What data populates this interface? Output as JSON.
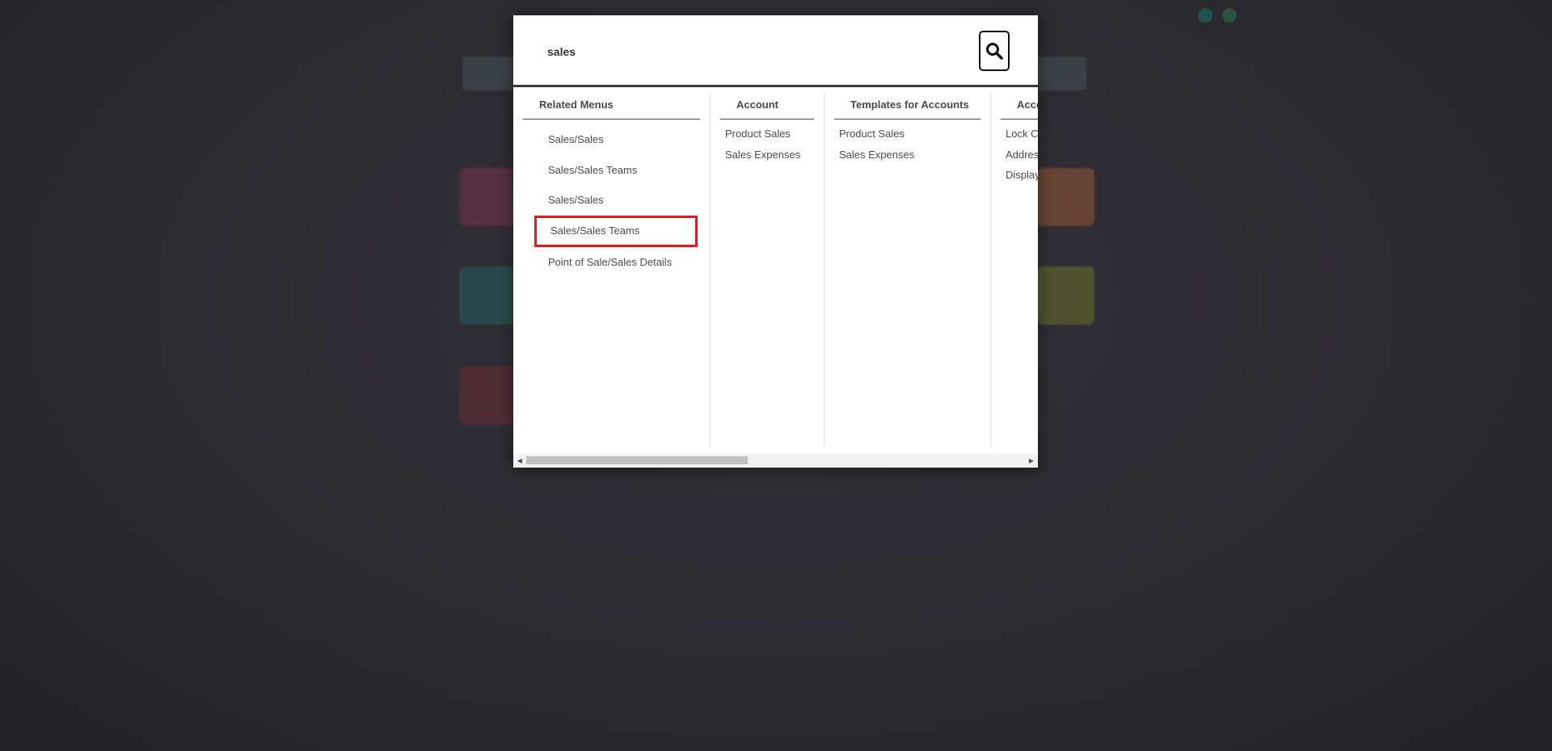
{
  "search": {
    "value": "sales",
    "button_icon": "search-icon"
  },
  "columns": [
    {
      "header": "Related Menus",
      "items": [
        "Sales/Sales",
        "Sales/Sales Teams",
        "Sales/Sales",
        "Sales/Sales Teams",
        "Point of Sale/Sales Details"
      ]
    },
    {
      "header": "Account",
      "items": [
        "Product Sales",
        "Sales Expenses"
      ]
    },
    {
      "header": "Templates for Accounts",
      "items": [
        "Product Sales",
        "Sales Expenses"
      ]
    },
    {
      "header": "Acce",
      "items": [
        "Lock C",
        "Addres",
        "Display"
      ]
    }
  ],
  "colors": {
    "highlight": "#e31b1b",
    "overlay": "#2a292e"
  }
}
